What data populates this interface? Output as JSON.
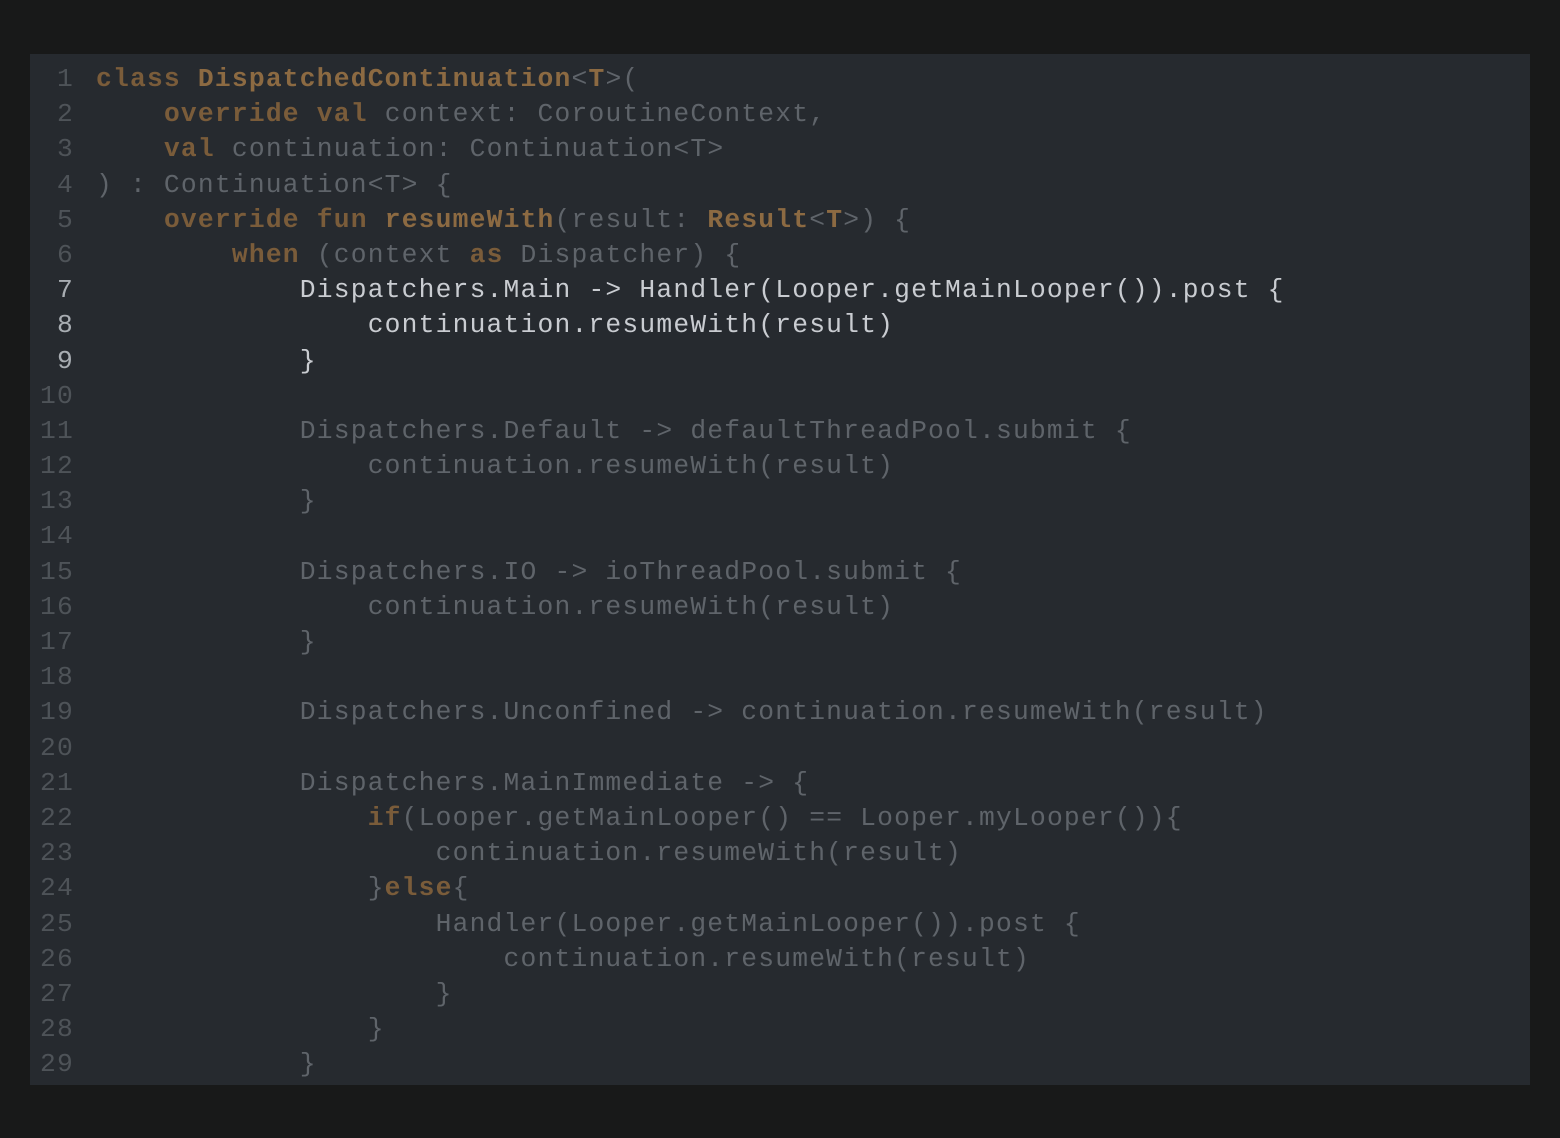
{
  "editor": {
    "lines": [
      {
        "n": "1",
        "hl": false,
        "tokens": [
          [
            "kw",
            "class"
          ],
          [
            "p",
            " "
          ],
          [
            "cls",
            "DispatchedContinuation"
          ],
          [
            "p",
            "<"
          ],
          [
            "tp",
            "T"
          ],
          [
            "p",
            ">("
          ]
        ]
      },
      {
        "n": "2",
        "hl": false,
        "tokens": [
          [
            "p",
            "    "
          ],
          [
            "kw",
            "override"
          ],
          [
            "p",
            " "
          ],
          [
            "kw",
            "val"
          ],
          [
            "p",
            " context: CoroutineContext,"
          ]
        ]
      },
      {
        "n": "3",
        "hl": false,
        "tokens": [
          [
            "p",
            "    "
          ],
          [
            "kw",
            "val"
          ],
          [
            "p",
            " continuation: Continuation<T>"
          ]
        ]
      },
      {
        "n": "4",
        "hl": false,
        "tokens": [
          [
            "p",
            ") : Continuation<T> {"
          ]
        ]
      },
      {
        "n": "5",
        "hl": false,
        "tokens": [
          [
            "p",
            "    "
          ],
          [
            "kw",
            "override"
          ],
          [
            "p",
            " "
          ],
          [
            "kw",
            "fun"
          ],
          [
            "p",
            " "
          ],
          [
            "fn",
            "resumeWith"
          ],
          [
            "p",
            "(result: "
          ],
          [
            "cls",
            "Result"
          ],
          [
            "p",
            "<"
          ],
          [
            "tp",
            "T"
          ],
          [
            "p",
            ">) {"
          ]
        ]
      },
      {
        "n": "6",
        "hl": false,
        "tokens": [
          [
            "p",
            "        "
          ],
          [
            "kw",
            "when"
          ],
          [
            "p",
            " (context "
          ],
          [
            "kw",
            "as"
          ],
          [
            "p",
            " Dispatcher) {"
          ]
        ]
      },
      {
        "n": "7",
        "hl": true,
        "tokens": [
          [
            "p",
            "            Dispatchers.Main -> Handler(Looper.getMainLooper()).post {"
          ]
        ]
      },
      {
        "n": "8",
        "hl": true,
        "tokens": [
          [
            "p",
            "                continuation.resumeWith(result)"
          ]
        ]
      },
      {
        "n": "9",
        "hl": true,
        "tokens": [
          [
            "p",
            "            }"
          ]
        ]
      },
      {
        "n": "10",
        "hl": false,
        "tokens": [
          [
            "p",
            ""
          ]
        ]
      },
      {
        "n": "11",
        "hl": false,
        "tokens": [
          [
            "p",
            "            Dispatchers.Default -> defaultThreadPool.submit {"
          ]
        ]
      },
      {
        "n": "12",
        "hl": false,
        "tokens": [
          [
            "p",
            "                continuation.resumeWith(result)"
          ]
        ]
      },
      {
        "n": "13",
        "hl": false,
        "tokens": [
          [
            "p",
            "            }"
          ]
        ]
      },
      {
        "n": "14",
        "hl": false,
        "tokens": [
          [
            "p",
            ""
          ]
        ]
      },
      {
        "n": "15",
        "hl": false,
        "tokens": [
          [
            "p",
            "            Dispatchers.IO -> ioThreadPool.submit {"
          ]
        ]
      },
      {
        "n": "16",
        "hl": false,
        "tokens": [
          [
            "p",
            "                continuation.resumeWith(result)"
          ]
        ]
      },
      {
        "n": "17",
        "hl": false,
        "tokens": [
          [
            "p",
            "            }"
          ]
        ]
      },
      {
        "n": "18",
        "hl": false,
        "tokens": [
          [
            "p",
            ""
          ]
        ]
      },
      {
        "n": "19",
        "hl": false,
        "tokens": [
          [
            "p",
            "            Dispatchers.Unconfined -> continuation.resumeWith(result)"
          ]
        ]
      },
      {
        "n": "20",
        "hl": false,
        "tokens": [
          [
            "p",
            ""
          ]
        ]
      },
      {
        "n": "21",
        "hl": false,
        "tokens": [
          [
            "p",
            "            Dispatchers.MainImmediate -> {"
          ]
        ]
      },
      {
        "n": "22",
        "hl": false,
        "tokens": [
          [
            "p",
            "                "
          ],
          [
            "kw",
            "if"
          ],
          [
            "p",
            "(Looper.getMainLooper() == Looper.myLooper()){"
          ]
        ]
      },
      {
        "n": "23",
        "hl": false,
        "tokens": [
          [
            "p",
            "                    continuation.resumeWith(result)"
          ]
        ]
      },
      {
        "n": "24",
        "hl": false,
        "tokens": [
          [
            "p",
            "                }"
          ],
          [
            "kw",
            "else"
          ],
          [
            "p",
            "{"
          ]
        ]
      },
      {
        "n": "25",
        "hl": false,
        "tokens": [
          [
            "p",
            "                    Handler(Looper.getMainLooper()).post {"
          ]
        ]
      },
      {
        "n": "26",
        "hl": false,
        "tokens": [
          [
            "p",
            "                        continuation.resumeWith(result)"
          ]
        ]
      },
      {
        "n": "27",
        "hl": false,
        "tokens": [
          [
            "p",
            "                    }"
          ]
        ]
      },
      {
        "n": "28",
        "hl": false,
        "tokens": [
          [
            "p",
            "                }"
          ]
        ]
      },
      {
        "n": "29",
        "hl": false,
        "tokens": [
          [
            "p",
            "            }"
          ]
        ]
      }
    ]
  }
}
